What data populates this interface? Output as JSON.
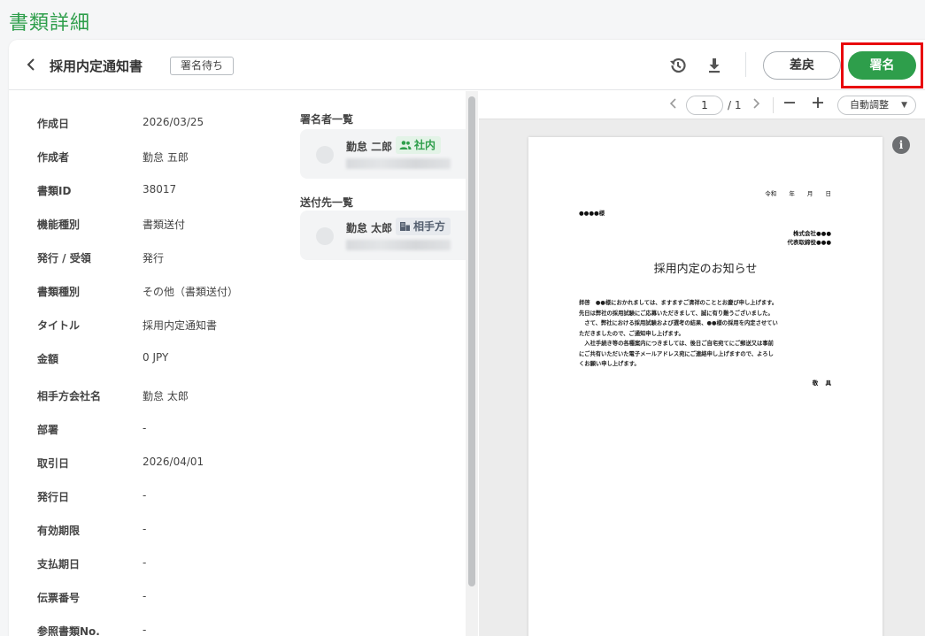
{
  "page_title": "書類詳細",
  "header": {
    "document_title": "採用内定通知書",
    "status_badge": "署名待ち",
    "icons": [
      "back-icon",
      "history-icon",
      "download-icon"
    ],
    "return_button": "差戻",
    "sign_button": "署名"
  },
  "details": [
    {
      "label": "作成日",
      "value": "2026/03/25"
    },
    {
      "label": "作成者",
      "value": "勤怠 五郎"
    },
    {
      "label": "書類ID",
      "value": "38017"
    },
    {
      "label": "機能種別",
      "value": "書類送付"
    },
    {
      "label": "発行 / 受領",
      "value": "発行"
    },
    {
      "label": "書類種別",
      "value": "その他（書類送付）"
    },
    {
      "label": "タイトル",
      "value": "採用内定通知書"
    },
    {
      "label": "金額",
      "value": "0 JPY"
    },
    {
      "label": "相手方会社名",
      "value": "勤怠 太郎"
    },
    {
      "label": "部署",
      "value": "-"
    },
    {
      "label": "取引日",
      "value": "2026/04/01"
    },
    {
      "label": "発行日",
      "value": "-"
    },
    {
      "label": "有効期限",
      "value": "-"
    },
    {
      "label": "支払期日",
      "value": "-"
    },
    {
      "label": "伝票番号",
      "value": "-"
    },
    {
      "label": "参照書類No.",
      "value": "-"
    }
  ],
  "signers": {
    "title": "署名者一覧",
    "items": [
      {
        "name": "勤怠 二郎",
        "tag": "社内"
      }
    ]
  },
  "recipients": {
    "title": "送付先一覧",
    "items": [
      {
        "name": "勤怠 太郎",
        "tag": "相手方"
      }
    ]
  },
  "viewer": {
    "page_current": "1",
    "page_total": "/ 1",
    "zoom": "自動調整",
    "document": {
      "date": "令和 年 月 日",
      "recipient": "●●●●様",
      "company": "株式会社●●●",
      "representative": "代表取締役●●●",
      "heading": "採用内定のお知らせ",
      "body": [
        "拝啓　●●様におかれましては、ますますご清祥のこととお慶び申し上げます。",
        "先日は弊社の採用試験にご応募いただきまして、誠に有り難うございました。",
        "　さて、弊社における採用試験および選考の結果、●●様の採用を内定させてい",
        "ただきましたので、ご通知申し上げます。",
        "　入社手続き等の各種案内につきましては、後日ご自宅宛てにご郵送又は事前",
        "にご共有いただいた電子メールアドレス宛にご連絡申し上げますので、よろし",
        "くお願い申し上げます。"
      ],
      "closing": "敬 具"
    }
  },
  "colors": {
    "brand_green": "#2e9e4b",
    "highlight_red": "#e8000b"
  }
}
